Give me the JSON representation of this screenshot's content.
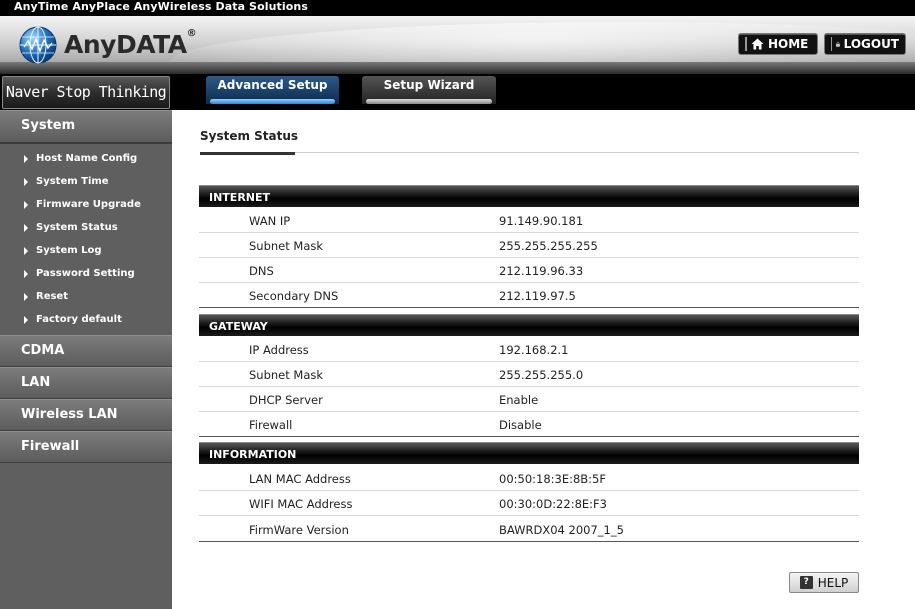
{
  "top_strip": {
    "text": "AnyTime AnyPlace AnyWireless Data Solutions"
  },
  "header": {
    "logo_text": "AnyDATA",
    "logo_mark": "®",
    "home_label": "HOME",
    "logout_label": "LOGOUT"
  },
  "nav": {
    "tagline": "Naver Stop Thinking",
    "tabs": [
      {
        "label": "Advanced Setup",
        "active": true
      },
      {
        "label": "Setup Wizard",
        "active": false
      }
    ]
  },
  "sidebar": {
    "system": {
      "label": "System",
      "items": [
        "Host Name Config",
        "System Time",
        "Firmware Upgrade",
        "System Status",
        "System Log",
        "Password Setting",
        "Reset",
        "Factory default"
      ]
    },
    "sections": [
      "CDMA",
      "LAN",
      "Wireless LAN",
      "Firewall"
    ]
  },
  "main": {
    "title": "System Status",
    "internet": {
      "header": "INTERNET",
      "rows": [
        {
          "label": "WAN IP",
          "value": "91.149.90.181"
        },
        {
          "label": "Subnet Mask",
          "value": "255.255.255.255"
        },
        {
          "label": "DNS",
          "value": "212.119.96.33"
        },
        {
          "label": "Secondary DNS",
          "value": "212.119.97.5"
        }
      ]
    },
    "gateway": {
      "header": "GATEWAY",
      "rows": [
        {
          "label": "IP Address",
          "value": "192.168.2.1"
        },
        {
          "label": "Subnet Mask",
          "value": "255.255.255.0"
        },
        {
          "label": "DHCP Server",
          "value": "Enable"
        },
        {
          "label": "Firewall",
          "value": "Disable"
        }
      ]
    },
    "information": {
      "header": "INFORMATION",
      "rows": [
        {
          "label": "LAN MAC Address",
          "value": "00:50:18:3E:8B:5F"
        },
        {
          "label": "WIFI MAC Address",
          "value": "00:30:0D:22:8E:F3"
        },
        {
          "label": "FirmWare Version",
          "value": "BAWRDX04 2007_1_5"
        }
      ]
    },
    "help_label": "HELP",
    "help_glyph": "?"
  },
  "colors": {
    "accent_tab": "#1f4f80",
    "sidebar_bg": "#5f5f5f",
    "section_header_bg": "#111111"
  },
  "icons": {
    "logo": "globe-logo-icon",
    "home": "house-icon",
    "logout": "lock-icon",
    "help": "question-icon",
    "submenu": "triangle-right-icon"
  }
}
